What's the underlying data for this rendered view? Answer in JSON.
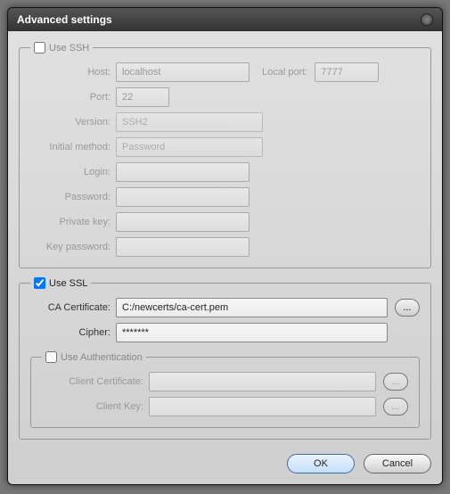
{
  "title": "Advanced settings",
  "ssh": {
    "enabled": false,
    "legend": "Use SSH",
    "host": {
      "label": "Host:",
      "value": "localhost"
    },
    "local_port": {
      "label": "Local port:",
      "value": "7777"
    },
    "port": {
      "label": "Port:",
      "value": "22"
    },
    "version": {
      "label": "Version:",
      "value": "SSH2"
    },
    "initial_method": {
      "label": "Initial method:",
      "value": "Password"
    },
    "login": {
      "label": "Login:",
      "value": ""
    },
    "password": {
      "label": "Password:",
      "value": ""
    },
    "private_key": {
      "label": "Private key:",
      "value": ""
    },
    "key_password": {
      "label": "Key password:",
      "value": ""
    }
  },
  "ssl": {
    "enabled": true,
    "legend": "Use SSL",
    "ca_cert": {
      "label": "CA Certificate:",
      "value": "C:/newcerts/ca-cert.pem"
    },
    "cipher": {
      "label": "Cipher:",
      "value": "*******"
    },
    "auth": {
      "enabled": false,
      "legend": "Use Authentication",
      "client_cert": {
        "label": "Client Certificate:",
        "value": ""
      },
      "client_key": {
        "label": "Client Key:",
        "value": ""
      }
    }
  },
  "buttons": {
    "browse": "...",
    "ok": "OK",
    "cancel": "Cancel"
  }
}
